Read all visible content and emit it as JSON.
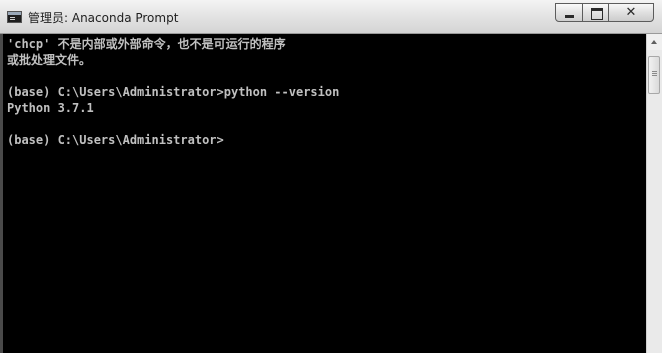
{
  "window": {
    "title": "管理员: Anaconda Prompt",
    "icon": "console-window-icon"
  },
  "caption_buttons": {
    "minimize_icon": "minimize-icon",
    "maximize_icon": "maximize-icon",
    "close_icon": "close-icon",
    "close_glyph": "✕"
  },
  "console": {
    "lines": [
      "'chcp' 不是内部或外部命令，也不是可运行的程序",
      "或批处理文件。",
      "",
      "(base) C:\\Users\\Administrator>python --version",
      "Python 3.7.1",
      "",
      "(base) C:\\Users\\Administrator>"
    ]
  },
  "colors": {
    "console_background": "#000000",
    "console_text": "#c0c0c0",
    "titlebar": "#e6e6e6"
  }
}
